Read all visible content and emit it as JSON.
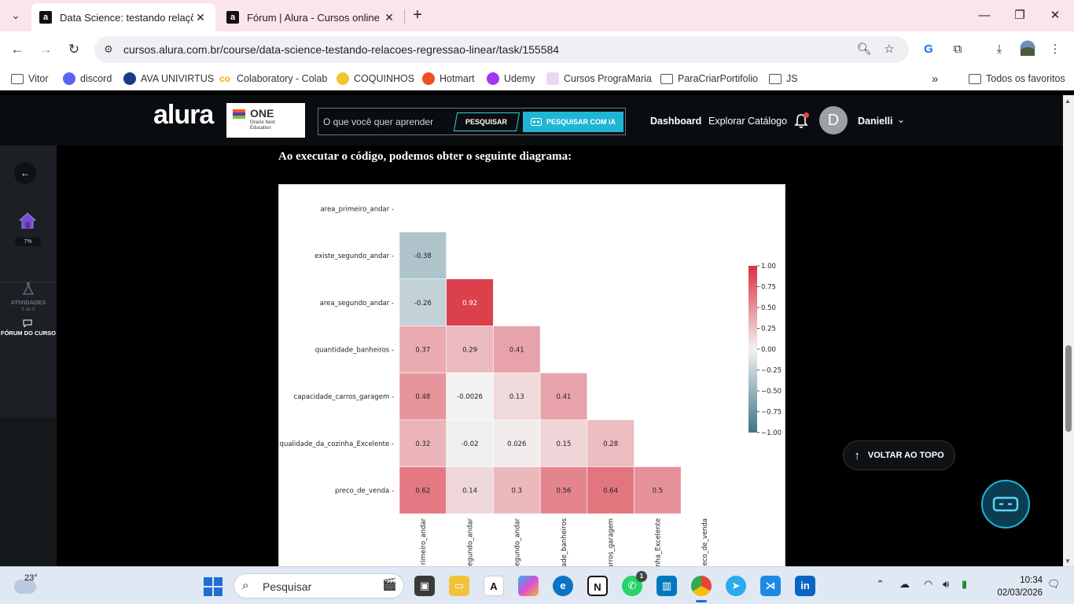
{
  "browser": {
    "tabs": [
      {
        "title": "Data Science: testando relações",
        "favicon": "a",
        "active": true
      },
      {
        "title": "Fórum | Alura - Cursos online de",
        "favicon": "a",
        "active": false
      }
    ],
    "url": "cursos.alura.com.br/course/data-science-testando-relacoes-regressao-linear/task/155584",
    "bookmarks": [
      {
        "label": "Vitor",
        "icon": "folder-icon"
      },
      {
        "label": "discord",
        "icon": "discord-icon"
      },
      {
        "label": "AVA UNIVIRTUS",
        "icon": "univirtus-icon"
      },
      {
        "label": "Colaboratory - Colab",
        "icon": "colab-icon"
      },
      {
        "label": "COQUINHOS",
        "icon": "coquinhos-icon"
      },
      {
        "label": "Hotmart",
        "icon": "hotmart-icon"
      },
      {
        "label": "Udemy",
        "icon": "udemy-icon"
      },
      {
        "label": "Cursos PrograMaria",
        "icon": "programaria-icon"
      },
      {
        "label": "ParaCriarPortifolio",
        "icon": "folder-icon"
      },
      {
        "label": "JS",
        "icon": "folder-icon"
      }
    ],
    "more_bookmarks": "»",
    "all_bookmarks": "Todos os favoritos"
  },
  "header": {
    "logo": "alura",
    "one_title": "ONE",
    "one_subtitle": "Oracle Next Education",
    "search_placeholder": "O que você quer aprender",
    "search_button": "PESQUISAR",
    "search_ai_button": "PESQUISAR COM IA",
    "dashboard": "Dashboard",
    "catalog": "Explorar Catálogo",
    "avatar_initial": "D",
    "username": "Danielli"
  },
  "sidebar": {
    "progress": "7%",
    "activities_label": "ATIVIDADES",
    "activities_count": "5 de 9",
    "forum_label": "FÓRUM DO CURSO"
  },
  "content": {
    "intro": "Ao executar o código, podemos obter o seguinte diagrama:"
  },
  "chart_data": {
    "type": "heatmap",
    "title": "",
    "row_labels": [
      "area_primeiro_andar",
      "existe_segundo_andar",
      "area_segundo_andar",
      "quantidade_banheiros",
      "capacidade_carros_garagem",
      "qualidade_da_cozinha_Excelente",
      "preco_de_venda"
    ],
    "col_labels": [
      "area_primeiro_andar",
      "existe_segundo_andar",
      "area_segundo_andar",
      "quantidade_banheiros",
      "capacidade_carros_garagem",
      "qualidade_da_cozinha_Excelente",
      "preco_de_venda"
    ],
    "col_labels_visible": [
      "rimeiro_andar",
      "egundo_andar",
      "egundo_andar",
      "ade_banheiros",
      "arros_garagem",
      "nha_Excelente",
      "eco_de_venda"
    ],
    "mask": "upper-triangle",
    "values": [
      [
        null,
        null,
        null,
        null,
        null,
        null,
        null
      ],
      [
        -0.38,
        null,
        null,
        null,
        null,
        null,
        null
      ],
      [
        -0.26,
        0.92,
        null,
        null,
        null,
        null,
        null
      ],
      [
        0.37,
        0.29,
        0.41,
        null,
        null,
        null,
        null
      ],
      [
        0.48,
        -0.0026,
        0.13,
        0.41,
        null,
        null,
        null
      ],
      [
        0.32,
        -0.02,
        0.026,
        0.15,
        0.28,
        null,
        null
      ],
      [
        0.62,
        0.14,
        0.3,
        0.56,
        0.64,
        0.5,
        null
      ]
    ],
    "value_labels": [
      [
        null,
        null,
        null,
        null,
        null,
        null,
        null
      ],
      [
        "-0.38",
        null,
        null,
        null,
        null,
        null,
        null
      ],
      [
        "-0.26",
        "0.92",
        null,
        null,
        null,
        null,
        null
      ],
      [
        "0.37",
        "0.29",
        "0.41",
        null,
        null,
        null,
        null
      ],
      [
        "0.48",
        "-0.0026",
        "0.13",
        "0.41",
        null,
        null,
        null
      ],
      [
        "0.32",
        "-0.02",
        "0.026",
        "0.15",
        "0.28",
        null,
        null
      ],
      [
        "0.62",
        "0.14",
        "0.3",
        "0.56",
        "0.64",
        "0.5",
        null
      ]
    ],
    "colorbar": {
      "range": [
        -1,
        1
      ],
      "ticks": [
        1.0,
        0.75,
        0.5,
        0.25,
        0.0,
        -0.25,
        -0.5,
        -0.75,
        -1.0
      ],
      "tick_labels": [
        "1.00",
        "0.75",
        "0.50",
        "0.25",
        "0.00",
        "−0.25",
        "−0.50",
        "−0.75",
        "−1.00"
      ],
      "colormap": "diverging teal-white-red",
      "neg_color": "#3e7588",
      "mid_color": "#f2f2f2",
      "pos_color": "#d9303f"
    }
  },
  "widgets": {
    "back_to_top": "VOLTAR AO TOPO"
  },
  "taskbar": {
    "temperature": "23°",
    "search_placeholder": "Pesquisar",
    "whatsapp_badge": "1",
    "time": "10:34",
    "date": "02/03/2026"
  }
}
